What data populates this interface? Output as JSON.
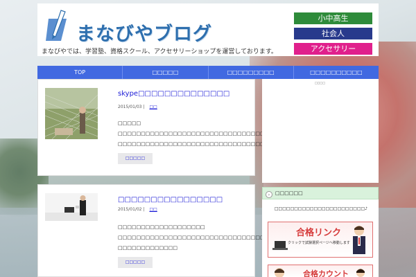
{
  "header": {
    "site_title": "まなびやブログ",
    "tagline": "まなびやでは、学習塾、資格スクール、アクセサリーショップを運営しております。",
    "categories": [
      "小中高生",
      "社会人",
      "アクセサリー"
    ]
  },
  "nav": {
    "items": [
      "TOP",
      "□□□□□",
      "□□□□□□□□□",
      "□□□□□□□□□□"
    ]
  },
  "posts": [
    {
      "title": "skype□□□□□□□□□□□□□□",
      "date": "2015/01/03",
      "category": "□□",
      "excerpt": "□□□□□ □□□□□□□□□□□□□□□□□□□□□□□□□□□□□□□□□□□□□□□□□□□□□□□□□ □□□□□□□□□□□□□□□□□□□□□□□□□□□□□□□□□□",
      "more": "□□□□□"
    },
    {
      "title": "□□□□□□□□□□□□□□□□",
      "date": "2015/01/02",
      "category": "□□",
      "excerpt": "□□□□□□□□□□□□□□□□□□□ □□□□□□□□□□□□□□□□□□□□□□□□□□□□□□□□□□□□□□□□□ □□□□□□□□□□□□□",
      "more": "□□□□□"
    }
  ],
  "sidebar": {
    "top_label": "□□□□",
    "widget_title": "□□□□□□",
    "widget_intro": "□□□□□□□□□□□□□□□□□□□□□□□♪",
    "banner1_title": "合格リンク",
    "banner1_sub": "クリックで試験選択ページへ移動します",
    "banner2_title": "合格カウント"
  },
  "colors": {
    "nav": "#4169e1",
    "cat_students": "#2e8b3a",
    "cat_adults": "#283a8c",
    "cat_accessory": "#e0208c",
    "link": "#1a1ad6",
    "logo": "#2e6fae"
  }
}
